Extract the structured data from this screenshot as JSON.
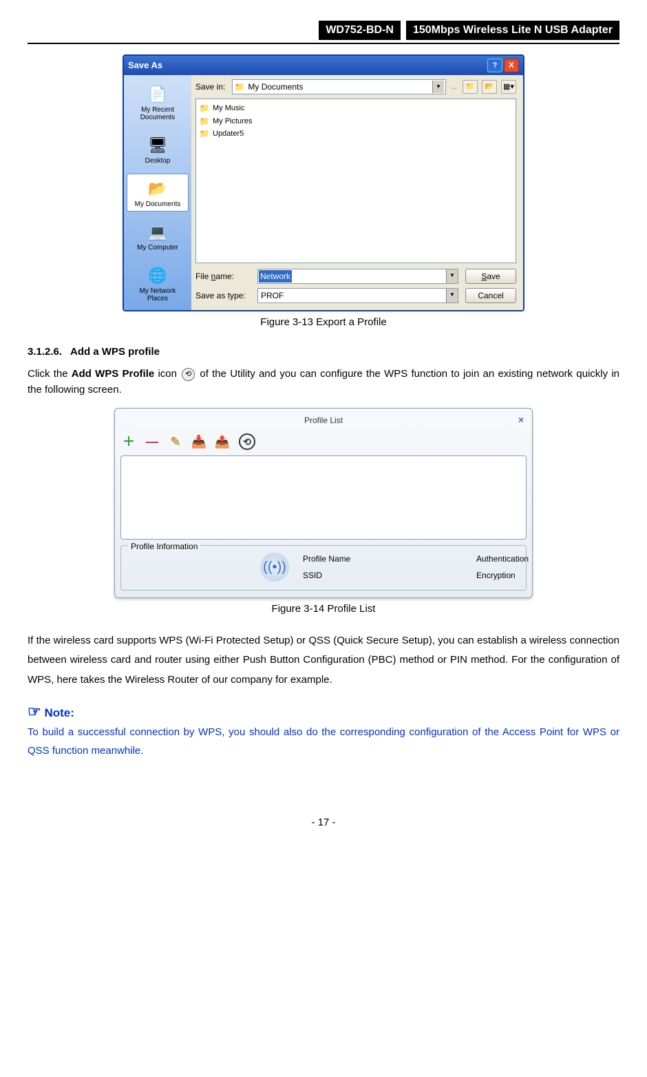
{
  "header": {
    "model": "WD752-BD-N",
    "title": "150Mbps Wireless Lite N USB Adapter"
  },
  "saveAs": {
    "windowTitle": "Save As",
    "saveInLabel": "Save in:",
    "saveInValue": "My Documents",
    "places": [
      {
        "name": "My Recent Documents",
        "icon": "📄"
      },
      {
        "name": "Desktop",
        "icon": "🖥"
      },
      {
        "name": "My Documents",
        "icon": "📂",
        "selected": true
      },
      {
        "name": "My Computer",
        "icon": "💻"
      },
      {
        "name": "My Network Places",
        "icon": "🌐"
      }
    ],
    "files": [
      {
        "name": "My Music",
        "icon": "📁"
      },
      {
        "name": "My Pictures",
        "icon": "📁"
      },
      {
        "name": "Updater5",
        "icon": "📁"
      }
    ],
    "fileNameLabel": "File name:",
    "fileNameValue": "Network",
    "saveTypeLabel": "Save as type:",
    "saveTypeValue": "PROF",
    "saveBtn": "Save",
    "cancelBtn": "Cancel"
  },
  "caption1": "Figure 3-13 Export a Profile",
  "section": {
    "number": "3.1.2.6.",
    "title": "Add a WPS profile"
  },
  "para1a": "Click the ",
  "para1b": "Add WPS Profile",
  "para1c": " icon ",
  "para1d": " of the Utility and you can configure the WPS function to join an existing network quickly in the following screen.",
  "profileList": {
    "title": "Profile List",
    "legend": "Profile Information",
    "row1a": "Profile Name",
    "row1b": "Authentication",
    "row2a": "SSID",
    "row2b": "Encryption"
  },
  "caption2": "Figure 3-14 Profile List",
  "para2": "If the wireless card supports WPS (Wi-Fi Protected Setup) or QSS (Quick Secure Setup), you can establish a wireless connection between wireless card and router using either Push Button Configuration (PBC) method or PIN method. For the configuration of WPS, here takes the Wireless Router of our company for example.",
  "note": {
    "heading": "Note:",
    "body": "To build a successful connection by WPS, you should also do the corresponding configuration of the Access Point for WPS or QSS function meanwhile."
  },
  "pageNum": "- 17 -"
}
